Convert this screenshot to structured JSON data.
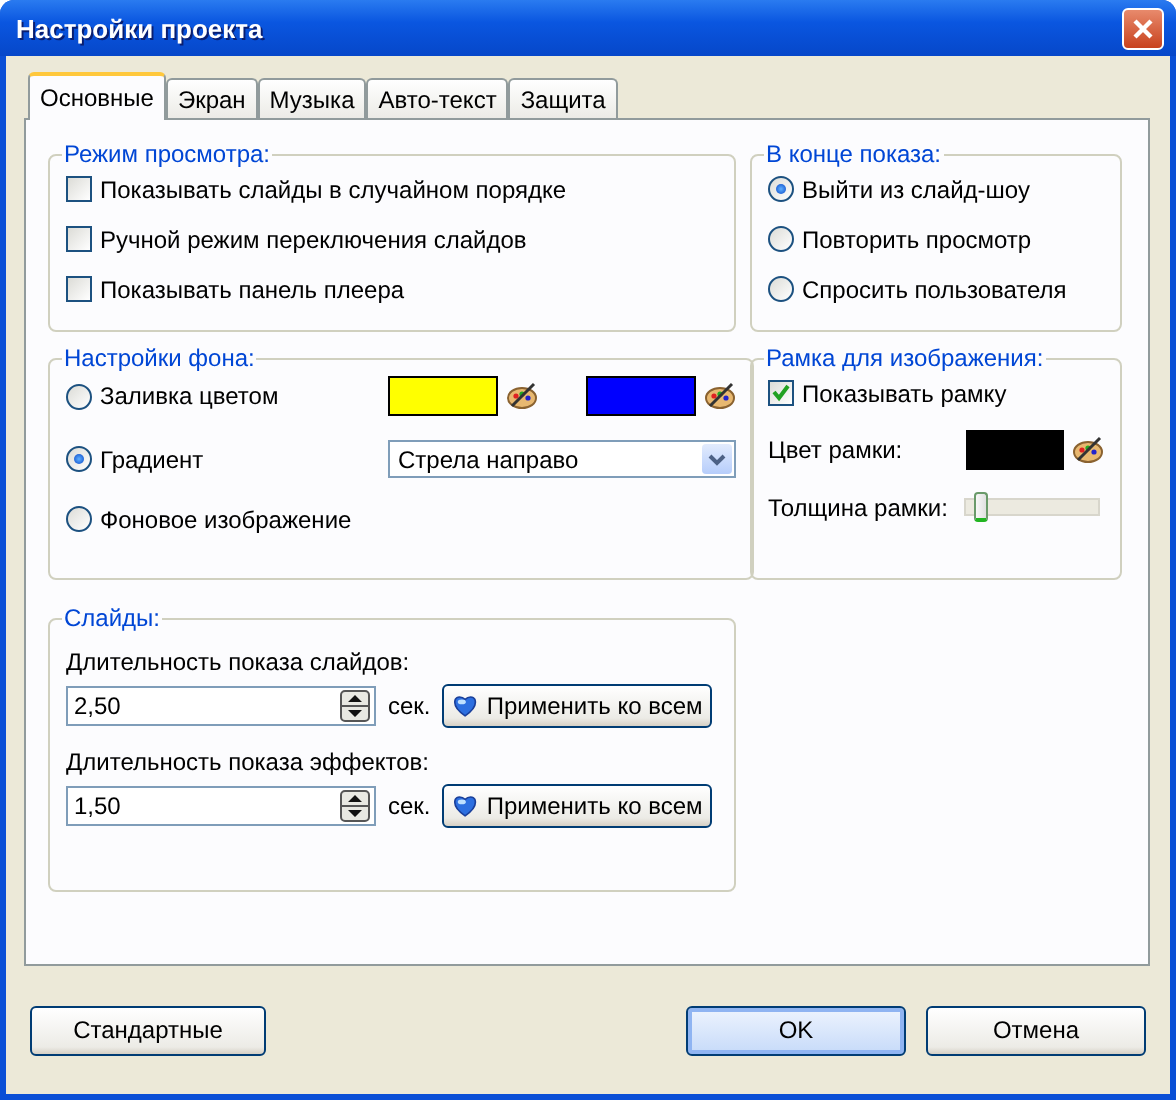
{
  "window": {
    "title": "Настройки проекта"
  },
  "tabs": [
    {
      "label": "Основные",
      "selected": true
    },
    {
      "label": "Экран",
      "selected": false
    },
    {
      "label": "Музыка",
      "selected": false
    },
    {
      "label": "Авто-текст",
      "selected": false
    },
    {
      "label": "Защита",
      "selected": false
    }
  ],
  "view_mode": {
    "title": "Режим просмотра:",
    "options": [
      {
        "label": "Показывать слайды в случайном порядке",
        "checked": false
      },
      {
        "label": "Ручной режим переключения слайдов",
        "checked": false
      },
      {
        "label": "Показывать панель плеера",
        "checked": false
      }
    ]
  },
  "background": {
    "title": "Настройки фона:",
    "options": [
      {
        "kind": "color",
        "label": "Заливка цветом",
        "selected": false,
        "swatches": [
          {
            "color": "#ffff00"
          },
          {
            "color": "#0000ff"
          }
        ]
      },
      {
        "kind": "gradient",
        "label": "Градиент",
        "selected": true,
        "value": "Стрела направо"
      },
      {
        "kind": "image",
        "label": "Фоновое изображение",
        "selected": false
      }
    ]
  },
  "slides": {
    "title": "Слайды:",
    "fields": [
      {
        "label": "Длительность показа слайдов:",
        "value": "2,50",
        "unit": "сек.",
        "button": "Применить ко всем"
      },
      {
        "label": "Длительность показа эффектов:",
        "value": "1,50",
        "unit": "сек.",
        "button": "Применить ко всем"
      }
    ]
  },
  "end_of_show": {
    "title": "В конце показа:",
    "options": [
      {
        "label": "Выйти из слайд-шоу",
        "selected": true
      },
      {
        "label": "Повторить просмотр",
        "selected": false
      },
      {
        "label": "Спросить пользователя",
        "selected": false
      }
    ]
  },
  "frame": {
    "title": "Рамка для изображения:",
    "show": {
      "label": "Показывать рамку",
      "checked": true
    },
    "color_label": "Цвет рамки:",
    "color": "#000000",
    "thickness_label": "Толщина рамки:",
    "thickness": {
      "level": 0.08
    }
  },
  "buttons": [
    {
      "label": "Стандартные",
      "kind": "default"
    },
    {
      "label": "OK",
      "kind": "primary"
    },
    {
      "label": "Отмена",
      "kind": "default"
    }
  ]
}
